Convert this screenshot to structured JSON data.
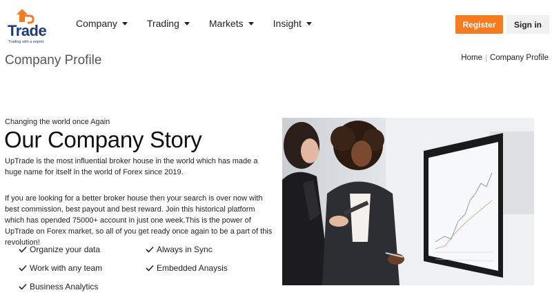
{
  "brand": {
    "logo_word": "Trade",
    "logo_tagline": "Trading with a expert",
    "accent_color": "#f47b20",
    "brand_color": "#1e3a78"
  },
  "nav": {
    "items": [
      {
        "label": "Company",
        "icon": "caret-down"
      },
      {
        "label": "Trading",
        "icon": "caret-down"
      },
      {
        "label": "Markets",
        "icon": "caret-down"
      },
      {
        "label": "Insight",
        "icon": "caret-down"
      }
    ]
  },
  "header": {
    "register_label": "Register",
    "signin_label": "Sign in"
  },
  "page": {
    "title": "Company Profile",
    "breadcrumb": [
      "Home",
      "Company Profile"
    ]
  },
  "story": {
    "eyebrow": "Changing the world once Again",
    "headline": "Our Company Story",
    "paragraph1": "UpTrade is the most influential broker house in the world which has made a huge name for itself in the world of Forex since 2019.",
    "paragraph2": "If you are looking for a better broker house then your search is over now with best commission, best payout and best reward. Join this historical platform which has opended 75000+ account in just one week.This is the power of UpTrade on Forex market, so all of you get ready once again to be a part of this revolution!",
    "features": [
      {
        "label": "Organize your data",
        "icon": "check-icon"
      },
      {
        "label": "Always in Sync",
        "icon": "check-icon"
      },
      {
        "label": "Work with any team",
        "icon": "check-icon"
      },
      {
        "label": "Embedded Anaysis",
        "icon": "check-icon"
      },
      {
        "label": "Business Analytics",
        "icon": "check-icon"
      }
    ]
  },
  "photo": {
    "subject": "two women looking at a trading chart on a monitor"
  }
}
